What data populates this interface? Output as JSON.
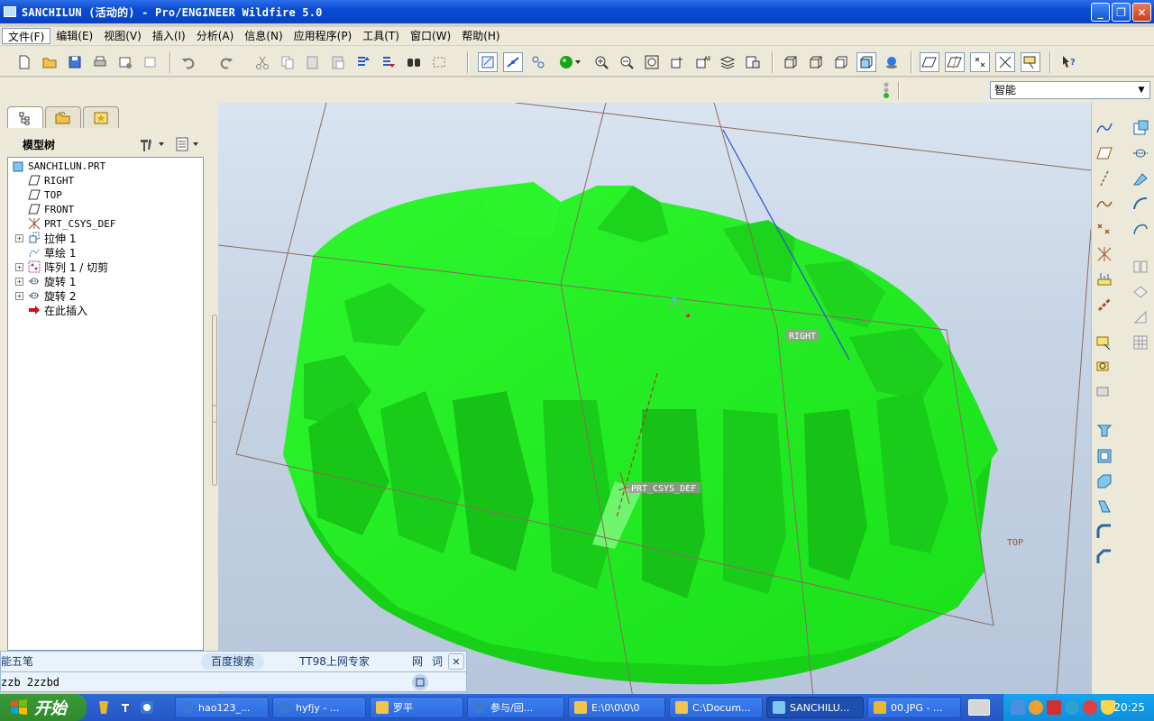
{
  "window": {
    "title": "SANCHILUN (活动的) - Pro/ENGINEER Wildfire 5.0",
    "controls": {
      "minimize": "_",
      "maximize": "❐",
      "close": "✕"
    }
  },
  "menu": [
    "文件(F)",
    "编辑(E)",
    "视图(V)",
    "插入(I)",
    "分析(A)",
    "信息(N)",
    "应用程序(P)",
    "工具(T)",
    "窗口(W)",
    "帮助(H)"
  ],
  "filter": {
    "value": "智能"
  },
  "model_tree": {
    "title": "模型树",
    "items": [
      {
        "label": "SANCHILUN.PRT",
        "icon": "part-icon",
        "expandable": false
      },
      {
        "label": "RIGHT",
        "icon": "datum-plane-icon",
        "expandable": false
      },
      {
        "label": "TOP",
        "icon": "datum-plane-icon",
        "expandable": false
      },
      {
        "label": "FRONT",
        "icon": "datum-plane-icon",
        "expandable": false
      },
      {
        "label": "PRT_CSYS_DEF",
        "icon": "csys-icon",
        "expandable": false
      },
      {
        "label": "拉伸 1",
        "icon": "extrude-icon",
        "expandable": true
      },
      {
        "label": "草绘 1",
        "icon": "sketch-icon",
        "expandable": false
      },
      {
        "label": "阵列 1 / 切剪",
        "icon": "pattern-icon",
        "expandable": true
      },
      {
        "label": "旋转 1",
        "icon": "revolve-icon",
        "expandable": true
      },
      {
        "label": "旋转 2",
        "icon": "revolve-icon",
        "expandable": true
      },
      {
        "label": "在此插入",
        "icon": "insert-arrow-icon",
        "expandable": false
      }
    ]
  },
  "viewport": {
    "labels": {
      "right": "RIGHT",
      "top": "TOP",
      "csys": "PRT_CSYS_DEF"
    },
    "model_color": "#22ee22"
  },
  "ime": {
    "name": "能五笔",
    "links": [
      "百度搜索",
      "TT98上网专家"
    ],
    "buttons": [
      "网",
      "词"
    ],
    "close": "✕",
    "input": "zzb 2zzbd"
  },
  "taskbar": {
    "start": "开始",
    "tasks": [
      {
        "label": "hao123_...",
        "icon_color": "#3a78d6"
      },
      {
        "label": "hyfjy - ...",
        "icon_color": "#3a78d6"
      },
      {
        "label": "罗平",
        "icon_color": "#f2c54b"
      },
      {
        "label": "参与/回...",
        "icon_color": "#3a78d6"
      },
      {
        "label": "E:\\0\\0\\0\\0",
        "icon_color": "#f2c54b"
      },
      {
        "label": "C:\\Docum...",
        "icon_color": "#f2c54b"
      },
      {
        "label": "SANCHILU...",
        "icon_color": "#7ec8f0",
        "active": true
      },
      {
        "label": "00.JPG - ...",
        "icon_color": "#e7b830"
      }
    ],
    "clock": "20:25"
  }
}
